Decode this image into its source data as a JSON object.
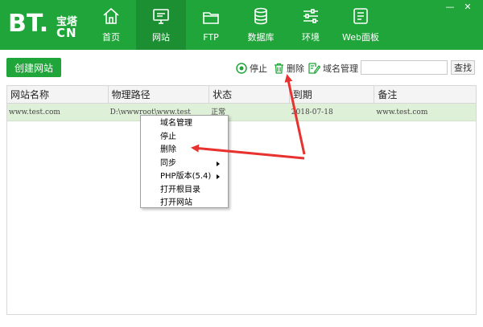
{
  "logo": {
    "main": "BT.",
    "cn_top": "宝塔",
    "cn_bottom": "CN"
  },
  "window_controls": [
    "—",
    "✕"
  ],
  "nav": [
    {
      "label": "首页",
      "icon": "home-icon"
    },
    {
      "label": "网站",
      "icon": "monitor-icon",
      "active": true
    },
    {
      "label": "FTP",
      "icon": "folder-icon"
    },
    {
      "label": "数据库",
      "icon": "database-icon"
    },
    {
      "label": "环境",
      "icon": "sliders-icon"
    },
    {
      "label": "Web面板",
      "icon": "panel-list-icon"
    }
  ],
  "toolbar": {
    "create_label": "创建网站",
    "stop_label": "停止",
    "delete_label": "删除",
    "domain_label": "域名管理",
    "search_placeholder": "",
    "search_label": "查找"
  },
  "table": {
    "headers": [
      "网站名称",
      "物理路径",
      "状态",
      "到期",
      "备注"
    ],
    "rows": [
      [
        "www.test.com",
        "D:\\wwwroot\\www.test",
        "正常",
        "2018-07-18",
        "www.test.com"
      ]
    ]
  },
  "context_menu": [
    {
      "label": "域名管理"
    },
    {
      "label": "停止"
    },
    {
      "label": "删除"
    },
    {
      "label": "同步",
      "submenu": true
    },
    {
      "label": "PHP版本(5.4)",
      "submenu": true
    },
    {
      "label": "打开根目录"
    },
    {
      "label": "打开网站"
    }
  ],
  "colors": {
    "brand_green": "#20a53a",
    "active_nav": "#1c8f33",
    "row_selected": "#dff0d8",
    "annotation_red": "#e8322f"
  }
}
